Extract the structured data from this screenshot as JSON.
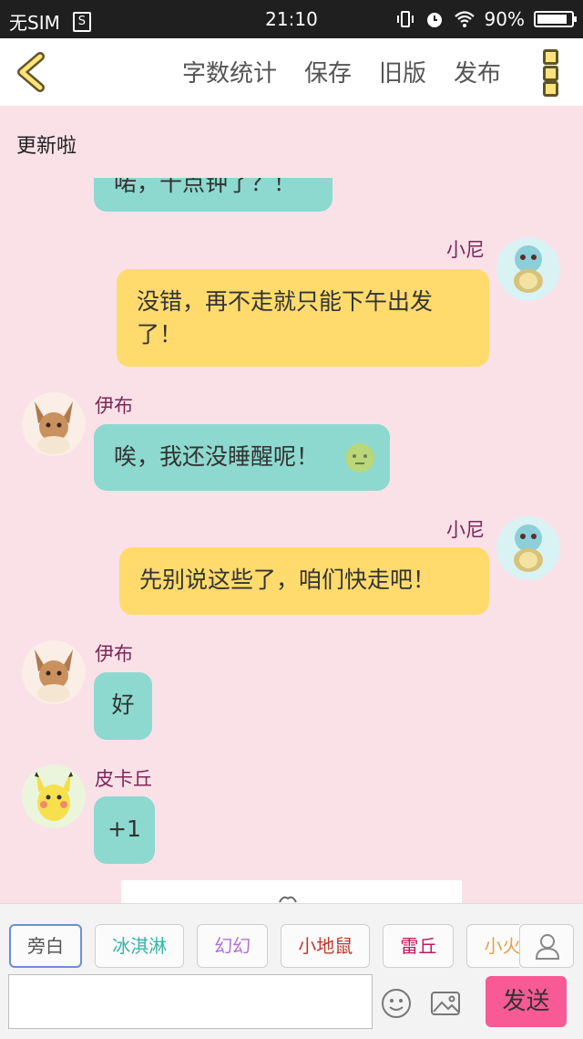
{
  "status_bar": {
    "carrier": "无SIM",
    "time": "21:10",
    "battery": "90%",
    "battery_level": 0.9
  },
  "toolbar": {
    "word_count": "字数统计",
    "save": "保存",
    "old_version": "旧版",
    "publish": "发布"
  },
  "chat": {
    "title": "更新啦",
    "messages": [
      {
        "side": "left",
        "speaker": "",
        "text": "喏，十点钟了？！",
        "color": "#8dd9cf"
      },
      {
        "side": "right",
        "speaker": "小尼",
        "text": "没错，再不走就只能下午出发了！",
        "color": "#ffdb6d"
      },
      {
        "side": "left",
        "speaker": "伊布",
        "text": "唉，我还没睡醒呢！",
        "color": "#8dd9cf"
      },
      {
        "side": "right",
        "speaker": "小尼",
        "text": "先别说这些了，咱们快走吧！",
        "color": "#ffdb6d"
      },
      {
        "side": "left",
        "speaker": "伊布",
        "text": "好",
        "color": "#8dd9cf"
      },
      {
        "side": "left",
        "speaker": "皮卡丘",
        "text": "+1",
        "color": "#8dd9cf"
      }
    ]
  },
  "roles": [
    {
      "label": "旁白",
      "color": "#555555"
    },
    {
      "label": "冰淇淋",
      "color": "#34b5a6"
    },
    {
      "label": "幻幻",
      "color": "#b070d8"
    },
    {
      "label": "小地鼠",
      "color": "#c0392b"
    },
    {
      "label": "雷丘",
      "color": "#c2185b"
    },
    {
      "label": "小火",
      "color": "#e6a04a"
    }
  ],
  "composer": {
    "placeholder": "",
    "send": "发送"
  },
  "colors": {
    "background": "#fae1e8",
    "teal_bubble": "#8dd9cf",
    "yellow_bubble": "#ffdb6d",
    "send_button": "#f75a94",
    "name_color": "#7c2858"
  }
}
